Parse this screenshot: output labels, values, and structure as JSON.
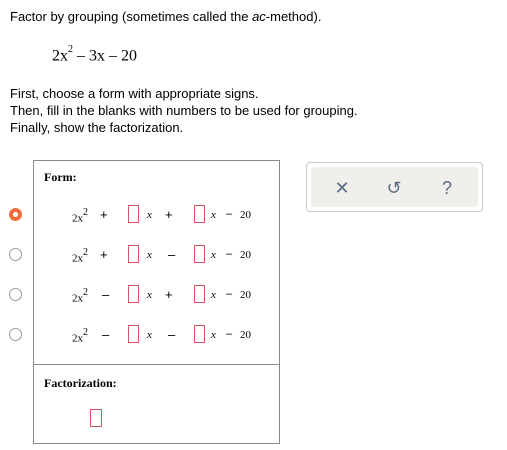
{
  "intro": {
    "before": "Factor by grouping (sometimes called the ",
    "em": "ac",
    "after": "-method)."
  },
  "problem": {
    "coef": "2x",
    "exp": "2",
    "rest": " – 3x – 20"
  },
  "instructions": [
    "First, choose a form with appropriate signs.",
    "Then, fill in the blanks with numbers to be used for grouping.",
    "Finally, show the factorization."
  ],
  "form_label": "Form:",
  "forms": [
    {
      "selected": true,
      "term": "2x",
      "exp": "2",
      "sign1": "+",
      "sign2": "+",
      "sign3": "–",
      "const": "20"
    },
    {
      "selected": false,
      "term": "2x",
      "exp": "2",
      "sign1": "+",
      "sign2": "–",
      "sign3": "–",
      "const": "20"
    },
    {
      "selected": false,
      "term": "2x",
      "exp": "2",
      "sign1": "–",
      "sign2": "+",
      "sign3": "–",
      "const": "20"
    },
    {
      "selected": false,
      "term": "2x",
      "exp": "2",
      "sign1": "–",
      "sign2": "–",
      "sign3": "–",
      "const": "20"
    }
  ],
  "variable": "x",
  "factorization_label": "Factorization:",
  "toolbar": {
    "clear_icon": "✕",
    "undo_icon": "↺",
    "help_icon": "?"
  },
  "colors": {
    "accent": "#f06e3c",
    "blank_border": "#d15668",
    "toolbar_bg": "#f0efeb",
    "icon": "#5a6d86"
  }
}
